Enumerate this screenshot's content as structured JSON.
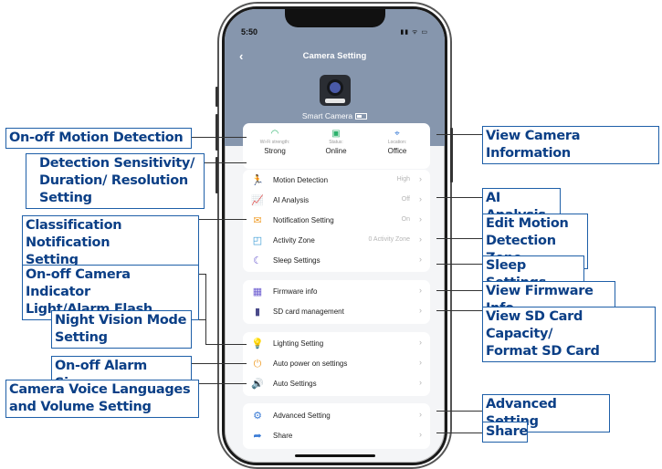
{
  "phone": {
    "status_time": "5:50",
    "status_icons": "▮▮ ᯤ ▭",
    "back_icon": "‹",
    "title": "Camera Setting",
    "camera_name": "Smart Camera",
    "info": [
      {
        "icon": "wifi-icon",
        "glyph": "◠",
        "label": "Wi-Fi strength:",
        "value": "Strong"
      },
      {
        "icon": "status-icon",
        "glyph": "▣",
        "label": "Status:",
        "value": "Online"
      },
      {
        "icon": "location-icon",
        "glyph": "⌖",
        "label": "Location:",
        "value": "Office"
      }
    ],
    "group1": [
      {
        "icon": "motion-detection-icon",
        "glyph": "🏃",
        "color": "#3a7bd5",
        "label": "Motion Detection",
        "value": "High"
      },
      {
        "icon": "ai-analysis-icon",
        "glyph": "📈",
        "color": "#e4576d",
        "label": "AI Analysis",
        "value": "Off"
      },
      {
        "icon": "notification-icon",
        "glyph": "✉",
        "color": "#f0a030",
        "label": "Notification Setting",
        "value": "On"
      },
      {
        "icon": "activity-zone-icon",
        "glyph": "◰",
        "color": "#3a9bd5",
        "label": "Activity Zone",
        "value": "0 Activity Zone"
      },
      {
        "icon": "sleep-icon",
        "glyph": "☾",
        "color": "#6b5bd0",
        "label": "Sleep Settings",
        "value": ""
      }
    ],
    "group2": [
      {
        "icon": "firmware-icon",
        "glyph": "▦",
        "color": "#6b5bd0",
        "label": "Firmware info",
        "value": ""
      },
      {
        "icon": "sd-card-icon",
        "glyph": "▮",
        "color": "#4a4a8a",
        "label": "SD card management",
        "value": ""
      }
    ],
    "group3": [
      {
        "icon": "lighting-icon",
        "glyph": "💡",
        "color": "#f0a030",
        "label": "Lighting Setting",
        "value": ""
      },
      {
        "icon": "auto-power-icon",
        "glyph": "⏻",
        "color": "#f0a030",
        "label": "Auto power on settings",
        "value": ""
      },
      {
        "icon": "auto-settings-icon",
        "glyph": "🔊",
        "color": "#f0a030",
        "label": "Auto Settings",
        "value": ""
      }
    ],
    "group4": [
      {
        "icon": "advanced-setting-icon",
        "glyph": "⚙",
        "color": "#3a7bd5",
        "label": "Advanced Setting",
        "value": ""
      },
      {
        "icon": "share-icon",
        "glyph": "➦",
        "color": "#3a7bd5",
        "label": "Share",
        "value": ""
      }
    ],
    "chevron": "›"
  },
  "callouts_left": [
    {
      "lines": [
        "On-off Motion Detection"
      ]
    },
    {
      "lines": [
        "Detection Sensitivity/",
        "Duration/ Resolution",
        "Setting"
      ]
    },
    {
      "lines": [
        "Classification Notification",
        "Setting"
      ]
    },
    {
      "lines": [
        "On-off Camera Indicator",
        "Light/Alarm Flash"
      ]
    },
    {
      "lines": [
        "Night Vision Mode",
        "Setting"
      ]
    },
    {
      "lines": [
        "On-off Alarm Siren"
      ]
    },
    {
      "lines": [
        "Camera Voice Languages",
        "and Volume Setting"
      ]
    }
  ],
  "callouts_right": [
    {
      "lines": [
        "View Camera Information"
      ]
    },
    {
      "lines": [
        "AI Analysis"
      ]
    },
    {
      "lines": [
        "Edit Motion",
        "Detection Zone"
      ]
    },
    {
      "lines": [
        "Sleep Settings"
      ]
    },
    {
      "lines": [
        "View Firmware Info"
      ]
    },
    {
      "lines": [
        "View SD Card Capacity/",
        "Format SD Card"
      ]
    },
    {
      "lines": [
        "Advanced Setting"
      ]
    },
    {
      "lines": [
        "Share"
      ]
    }
  ]
}
